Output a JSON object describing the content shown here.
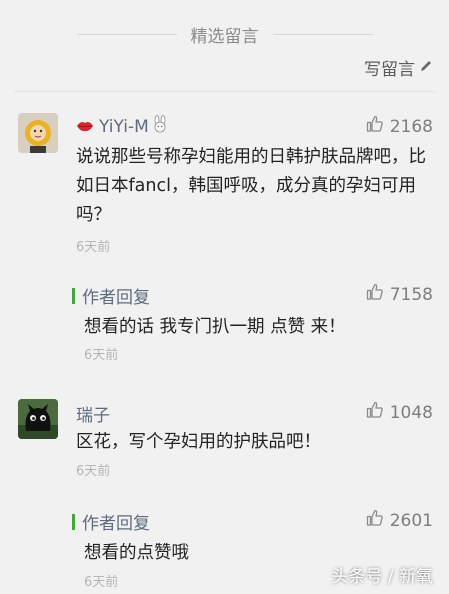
{
  "section": {
    "title": "精选留言"
  },
  "write_comment": {
    "label": "写留言"
  },
  "comments": [
    {
      "author": "YiYi-M",
      "likes": "2168",
      "text": "说说那些号称孕妇能用的日韩护肤品牌吧，比如日本fancl，韩国呼吸，成分真的孕妇可用吗？",
      "time": "6天前",
      "reply": {
        "label": "作者回复",
        "likes": "7158",
        "text": "想看的话 我专门扒一期 点赞 来！",
        "time": "6天前"
      }
    },
    {
      "author": "瑞子",
      "likes": "1048",
      "text": "区花，写个孕妇用的护肤品吧！",
      "time": "6天前",
      "reply": {
        "label": "作者回复",
        "likes": "2601",
        "text": "想看的点赞哦",
        "time": "6天前"
      }
    }
  ],
  "watermark": "头条号 / 新氧",
  "colors": {
    "name": "#5f6a7e",
    "reply_bar": "#3fa63a",
    "background": "#f1f1f1"
  }
}
